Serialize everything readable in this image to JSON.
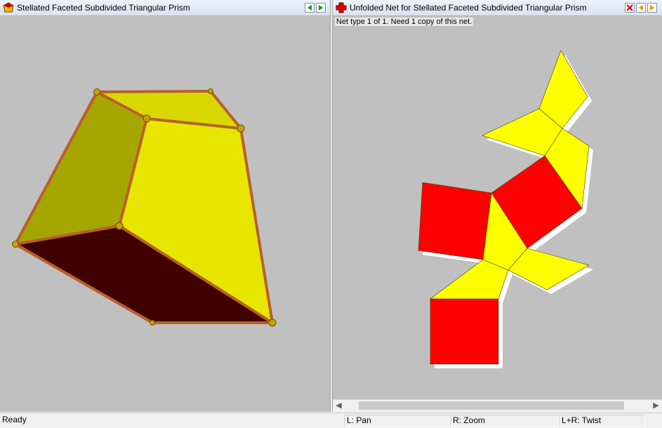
{
  "left_window": {
    "title": "Stellated Faceted Subdivided Triangular Prism",
    "icon": "polyhedron-icon"
  },
  "right_window": {
    "title": "Unfolded Net for Stellated Faceted Subdivided Triangular Prism",
    "icon": "net-cross-icon",
    "net_info": "Net type 1 of 1.  Need 1 copy of this net."
  },
  "statusbar": {
    "ready": "Ready",
    "pan": "L: Pan",
    "zoom": "R: Zoom",
    "twist": "L+R: Twist"
  },
  "colors": {
    "face_yellow": "#e6e600",
    "face_olive": "#a6a600",
    "face_dark_red": "#3f0000",
    "net_red": "#ff0000",
    "net_yellow": "#ffff00",
    "background": "#c0c0c0"
  }
}
